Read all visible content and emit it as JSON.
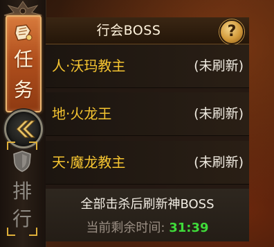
{
  "sidebar": {
    "tabs": [
      {
        "label_top": "任",
        "label_bottom": "务",
        "icon": "scroll-bell-icon",
        "active": true
      },
      {
        "label_top": "排",
        "label_bottom": "行",
        "icon": "shield-icon",
        "active": false
      }
    ],
    "collapse_icon": "double-chevron-left-icon"
  },
  "panel": {
    "title": "行会BOSS",
    "help_label": "?",
    "bosses": [
      {
        "name": "人·沃玛教主",
        "status": "(未刷新)"
      },
      {
        "name": "地·火龙王",
        "status": "(未刷新)"
      },
      {
        "name": "天·魔龙教主",
        "status": "(未刷新)"
      }
    ],
    "footer_note": "全部击杀后刷新神BOSS",
    "timer_label": "当前剩余时间:",
    "timer_value": "31:39"
  },
  "colors": {
    "boss_name": "#f6c531",
    "timer_value": "#3fdb3a",
    "active_tab": "#c0602a"
  }
}
